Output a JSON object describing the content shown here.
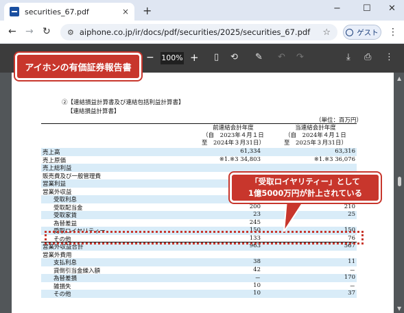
{
  "browser": {
    "tab_title": "securities_67.pdf",
    "tab_close": "×",
    "new_tab": "+",
    "window_controls": {
      "minimize": "−",
      "maximize": "☐",
      "close": "✕"
    },
    "url": "aiphone.co.jp/ir/docs/pdf/securities/2025/securities_67.pdf",
    "guest_label": "ゲスト",
    "colors": {
      "tabbar": "#dfe6f2",
      "accent": "#1a4fa0"
    }
  },
  "pdf_toolbar": {
    "zoom_value": "100%",
    "zoom_minus": "−",
    "zoom_plus": "+"
  },
  "document": {
    "section_title": "②【連結損益計算書及び連結包括利益計算書】",
    "sub_title": "【連結損益計算書】",
    "unit": "（単位：百万円）",
    "columns": [
      {
        "title": "前連結会計年度",
        "from": "（自　2023年４月１日",
        "to": "至　2024年３月31日）"
      },
      {
        "title": "当連結会計年度",
        "from": "（自　2024年４月１日",
        "to": "至　2025年３月31日）"
      }
    ],
    "rows": [
      {
        "label": "売上高",
        "prev": "61,334",
        "curr": "63,316",
        "indent": false,
        "hl": true
      },
      {
        "label": "売上原価",
        "prev": "※1.※3 34,803",
        "curr": "※1.※3 36,076",
        "indent": false,
        "hl": false
      },
      {
        "label": "売上総利益",
        "prev": "",
        "curr": "",
        "indent": false,
        "hl": true
      },
      {
        "label": "販売費及び一般管理費",
        "prev": "",
        "curr": "",
        "indent": false,
        "hl": false
      },
      {
        "label": "営業利益",
        "prev": "",
        "curr": "",
        "indent": false,
        "hl": true
      },
      {
        "label": "営業外収益",
        "prev": "",
        "curr": "",
        "indent": false,
        "hl": false
      },
      {
        "label": "受取利息",
        "prev": "",
        "curr": "",
        "indent": true,
        "hl": true
      },
      {
        "label": "受取配当金",
        "prev": "200",
        "curr": "210",
        "indent": true,
        "hl": false
      },
      {
        "label": "受取家賃",
        "prev": "23",
        "curr": "25",
        "indent": true,
        "hl": true
      },
      {
        "label": "為替差益",
        "prev": "245",
        "curr": "",
        "indent": true,
        "hl": false
      },
      {
        "label": "受取ロイヤリティー",
        "prev": "150",
        "curr": "150",
        "indent": true,
        "hl": true
      },
      {
        "label": "その他",
        "prev": "133",
        "curr": "76",
        "indent": true,
        "hl": false
      },
      {
        "label": "営業外収益合計",
        "prev": "963",
        "curr": "567",
        "indent": false,
        "hl": true
      },
      {
        "label": "営業外費用",
        "prev": "",
        "curr": "",
        "indent": false,
        "hl": false
      },
      {
        "label": "支払利息",
        "prev": "38",
        "curr": "11",
        "indent": true,
        "hl": true
      },
      {
        "label": "貸倒引当金繰入額",
        "prev": "42",
        "curr": "－",
        "indent": true,
        "hl": false
      },
      {
        "label": "為替差損",
        "prev": "－",
        "curr": "170",
        "indent": true,
        "hl": true
      },
      {
        "label": "雑損失",
        "prev": "10",
        "curr": "－",
        "indent": true,
        "hl": false
      },
      {
        "label": "その他",
        "prev": "10",
        "curr": "37",
        "indent": true,
        "hl": true
      }
    ]
  },
  "annotations": {
    "title_callout": "アイホンの有価証券報告書",
    "note_line1": "「受取ロイヤリティー」として",
    "note_line2": "1億5000万円が計上されている",
    "color": "#c8362c"
  }
}
